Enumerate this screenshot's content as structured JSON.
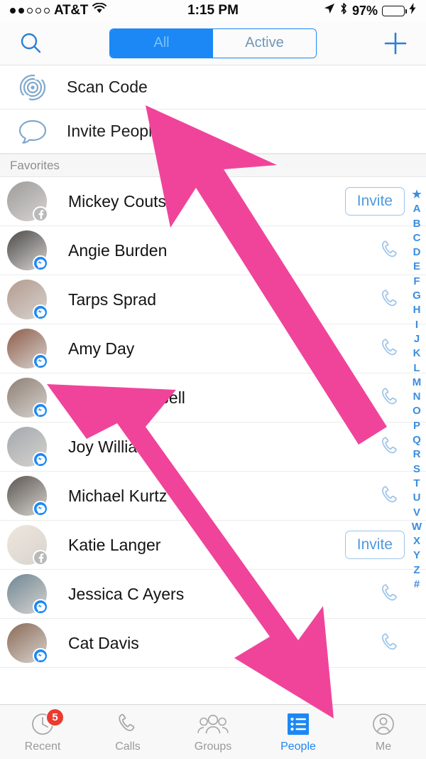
{
  "status_bar": {
    "signal_dots": [
      true,
      true,
      false,
      false,
      false
    ],
    "carrier": "AT&T",
    "wifi_icon": "wifi-icon",
    "time": "1:15 PM",
    "location_icon": "location-arrow-icon",
    "bluetooth_icon": "bluetooth-icon",
    "battery_percent": "97%",
    "battery_level": 97,
    "charging_icon": "lightning-bolt-icon",
    "battery_color": "#4cd964"
  },
  "nav_bar": {
    "search_icon": "search-icon",
    "add_icon": "plus-icon",
    "segments": [
      {
        "label": "All",
        "active": true
      },
      {
        "label": "Active",
        "active": false
      }
    ],
    "accent_color": "#1b88f5"
  },
  "actions": [
    {
      "label": "Scan Code",
      "icon": "scan-code-icon"
    },
    {
      "label": "Invite People",
      "icon": "speech-bubble-icon"
    }
  ],
  "section": {
    "title": "Favorites"
  },
  "contacts": [
    {
      "name": "Mickey Couts",
      "badge": "facebook",
      "action": "invite",
      "avatar_color": "#9c9c9c"
    },
    {
      "name": "Angie Burden",
      "badge": "messenger",
      "action": "call",
      "avatar_color": "#4a4a4a"
    },
    {
      "name": "Tarps Sprad",
      "badge": "messenger",
      "action": "call",
      "avatar_color": "#b39b8e"
    },
    {
      "name": "Amy Day",
      "badge": "messenger",
      "action": "call",
      "avatar_color": "#8e5c4a"
    },
    {
      "name": "Jayne Campbell",
      "badge": "messenger",
      "action": "call",
      "avatar_color": "#8d7f74"
    },
    {
      "name": "Joy Williams",
      "badge": "messenger",
      "action": "call",
      "avatar_color": "#a2a8ae"
    },
    {
      "name": "Michael Kurtz",
      "badge": "messenger",
      "action": "call",
      "avatar_color": "#5a5550"
    },
    {
      "name": "Katie Langer",
      "badge": "facebook",
      "action": "invite",
      "avatar_color": "#efe7dc"
    },
    {
      "name": "Jessica C Ayers",
      "badge": "messenger",
      "action": "call",
      "avatar_color": "#6e8794"
    },
    {
      "name": "Cat Davis",
      "badge": "messenger",
      "action": "call",
      "avatar_color": "#8a6a55"
    }
  ],
  "invite_label": "Invite",
  "index_strip": [
    "★",
    "A",
    "B",
    "C",
    "D",
    "E",
    "F",
    "G",
    "H",
    "I",
    "J",
    "K",
    "L",
    "M",
    "N",
    "O",
    "P",
    "Q",
    "R",
    "S",
    "T",
    "U",
    "V",
    "W",
    "X",
    "Y",
    "Z",
    "#"
  ],
  "tab_bar": {
    "tabs": [
      {
        "label": "Recent",
        "icon": "clock-icon",
        "active": false,
        "badge": "5"
      },
      {
        "label": "Calls",
        "icon": "phone-icon",
        "active": false,
        "badge": ""
      },
      {
        "label": "Groups",
        "icon": "people-group-icon",
        "active": false,
        "badge": ""
      },
      {
        "label": "People",
        "icon": "list-icon",
        "active": true,
        "badge": ""
      },
      {
        "label": "Me",
        "icon": "person-icon",
        "active": false,
        "badge": ""
      }
    ],
    "active_color": "#1b88f5",
    "badge_color": "#eb3b2e"
  },
  "annotations": {
    "arrow_color": "#f0449b",
    "arrow_count": 2
  }
}
